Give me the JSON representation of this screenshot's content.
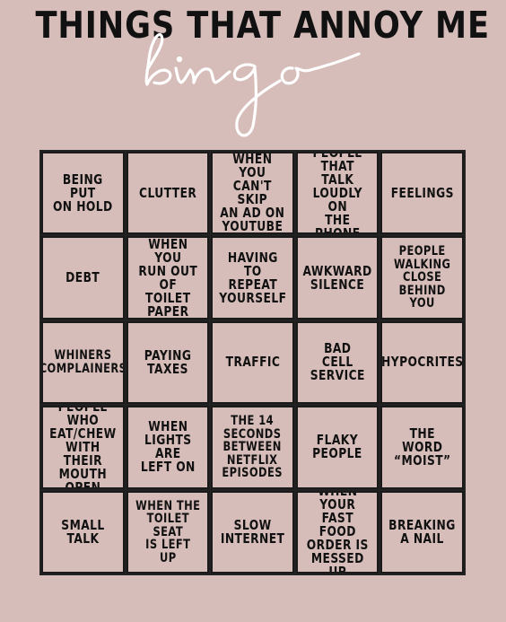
{
  "header": {
    "title": "THINGS THAT ANNOY ME",
    "script_word": "bingo"
  },
  "board": {
    "cells": [
      "BEING PUT\nON HOLD",
      "CLUTTER",
      "WHEN YOU\nCAN'T SKIP\nAN AD ON\nYOUTUBE",
      "PEOPLE\nTHAT TALK\nLOUDLY ON\nTHE PHONE",
      "FEELINGS",
      "DEBT",
      "WHEN YOU\nRUN OUT OF\nTOILET\nPAPER",
      "HAVING TO\nREPEAT\nYOURSELF",
      "AWKWARD\nSILENCE",
      "PEOPLE\nWALKING\nCLOSE\nBEHIND\nYOU",
      "WHINERS\nCOMPLAINERS",
      "PAYING\nTAXES",
      "TRAFFIC",
      "BAD\nCELL\nSERVICE",
      "HYPOCRITES",
      "PEOPLE WHO\nEAT/CHEW\nWITH THEIR\nMOUTH OPEN",
      "WHEN\nLIGHTS ARE\nLEFT ON",
      "THE 14\nSECONDS\nBETWEEN\nNETFLIX\nEPISODES",
      "FLAKY\nPEOPLE",
      "THE\nWORD\n“MOIST”",
      "SMALL\nTALK",
      "WHEN THE\nTOILET SEAT\nIS LEFT UP",
      "SLOW\nINTERNET",
      "WHEN YOUR\nFAST FOOD\nORDER IS\nMESSED UP",
      "BREAKING\nA NAIL"
    ]
  },
  "colors": {
    "background": "#d6bdb9",
    "ink": "#111111",
    "script": "#ffffff"
  }
}
